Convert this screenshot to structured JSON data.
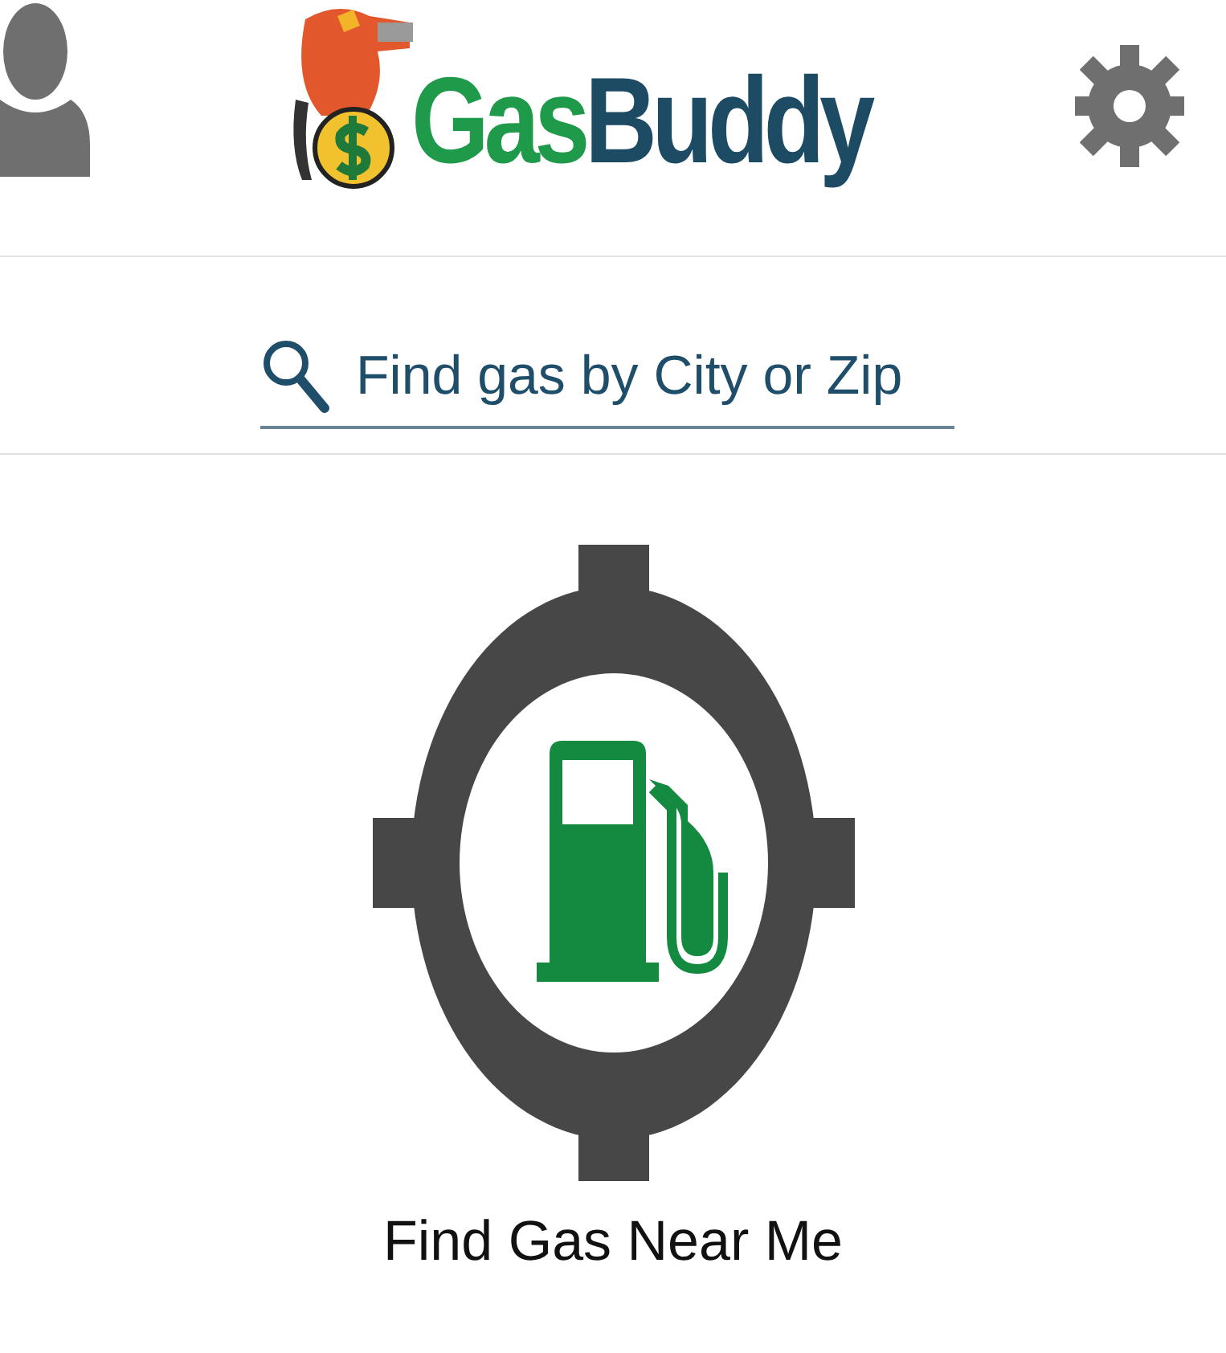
{
  "header": {
    "logo_parts": [
      "Gas",
      "Buddy"
    ]
  },
  "search": {
    "placeholder": "Find gas by City or Zip"
  },
  "locate_button": {
    "label": "Find Gas Near Me"
  }
}
